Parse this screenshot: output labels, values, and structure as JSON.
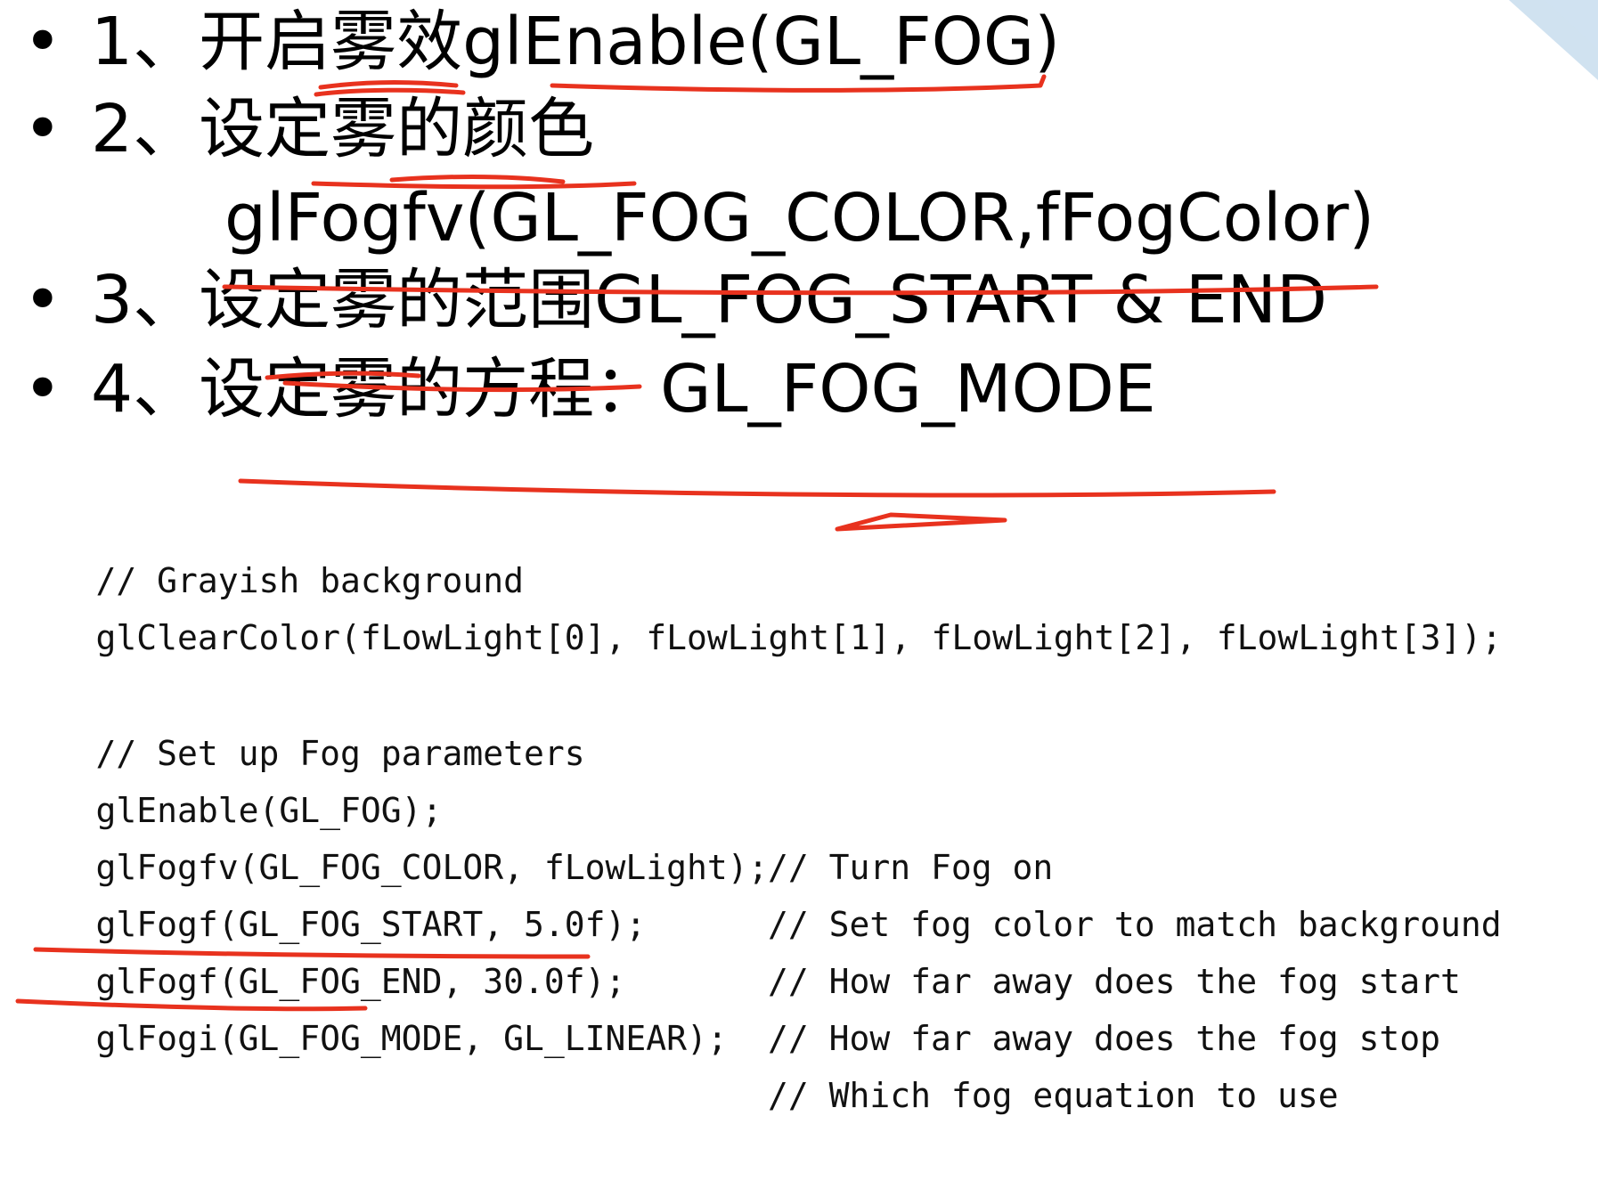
{
  "colors": {
    "annotation": "#e8321e",
    "corner_accent": "#a9cbe4"
  },
  "bullets": [
    {
      "marker": "•",
      "text": "1、开启雾效glEnable(GL_FOG)"
    },
    {
      "marker": "•",
      "text": "2、设定雾的颜色"
    },
    {
      "marker": "",
      "text": "glFogfv(GL_FOG_COLOR,fFogColor)"
    },
    {
      "marker": "•",
      "text": "3、设定雾的范围GL_FOG_START & END"
    },
    {
      "marker": "•",
      "text": "4、设定雾的方程：GL_FOG_MODE"
    }
  ],
  "code": [
    {
      "code": "// Grayish background",
      "comment": ""
    },
    {
      "code": "glClearColor(fLowLight[0], fLowLight[1], fLowLight[2], fLowLight[3]);",
      "comment": ""
    },
    {
      "code": "",
      "comment": ""
    },
    {
      "code": "// Set up Fog parameters",
      "comment": ""
    },
    {
      "code": "glEnable(GL_FOG);",
      "comment": "// Turn Fog on"
    },
    {
      "code": "glFogfv(GL_FOG_COLOR, fLowLight);",
      "comment": "// Set fog color to match background"
    },
    {
      "code": "glFogf(GL_FOG_START, 5.0f);",
      "comment": "// How far away does the fog start"
    },
    {
      "code": "glFogf(GL_FOG_END, 30.0f);",
      "comment": "// How far away does the fog stop"
    },
    {
      "code": "glFogi(GL_FOG_MODE, GL_LINEAR);",
      "comment": "// Which fog equation to use"
    }
  ]
}
